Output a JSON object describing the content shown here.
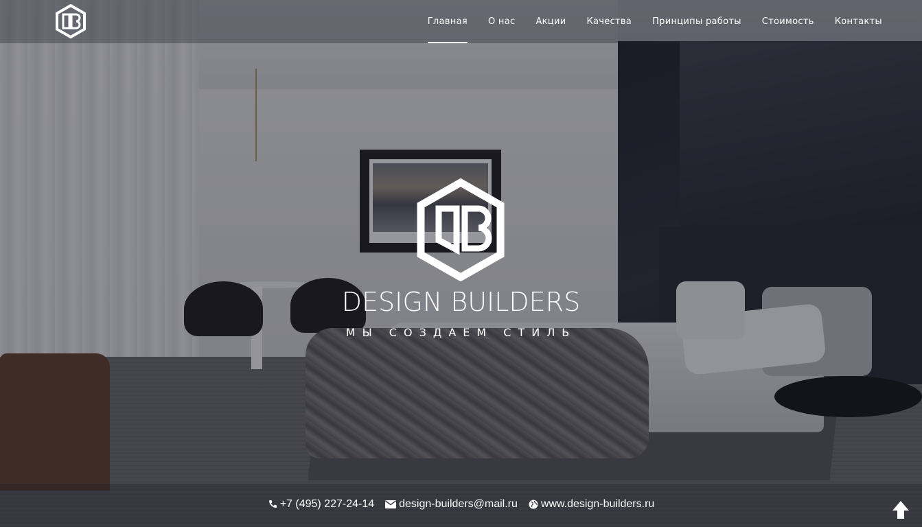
{
  "header": {
    "logo_icon": "db-hexagon-logo-icon",
    "nav": [
      {
        "label": "Главная",
        "active": true
      },
      {
        "label": "О нас",
        "active": false
      },
      {
        "label": "Акции",
        "active": false
      },
      {
        "label": "Качества",
        "active": false
      },
      {
        "label": "Принципы работы",
        "active": false
      },
      {
        "label": "Стоимость",
        "active": false
      },
      {
        "label": "Контакты",
        "active": false
      }
    ]
  },
  "hero": {
    "logo_icon": "db-hexagon-logo-icon",
    "title": "DESIGN BUILDERS",
    "slogan": "МЫ СОЗДАЕМ СТИЛЬ"
  },
  "footer": {
    "phone": {
      "icon": "phone-icon",
      "text": "+7 (495) 227-24-14"
    },
    "email": {
      "icon": "envelope-icon",
      "text": "design-builders@mail.ru"
    },
    "website": {
      "icon": "globe-icon",
      "text": "www.design-builders.ru"
    },
    "scroll_top_icon": "arrow-up-icon"
  },
  "colors": {
    "text": "#ffffff",
    "overlay": "#141620"
  }
}
